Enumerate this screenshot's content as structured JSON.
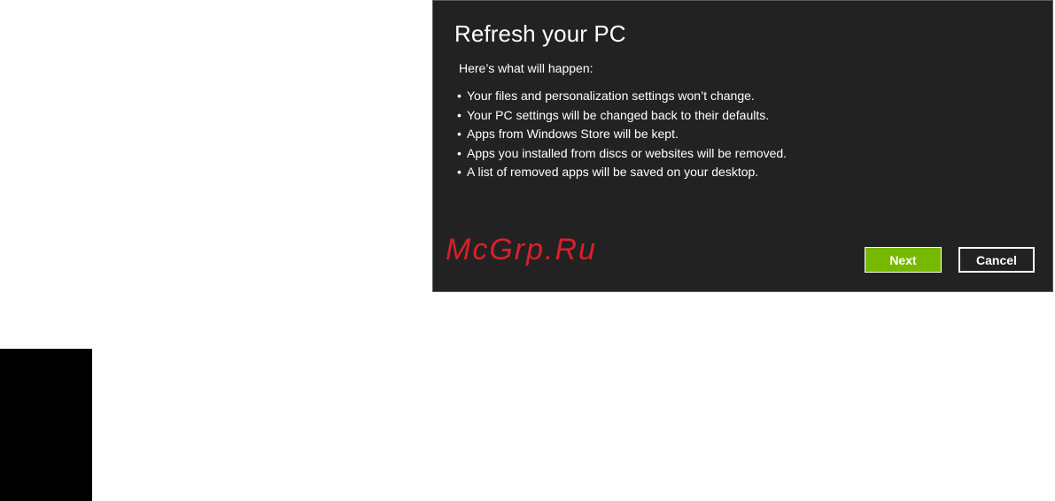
{
  "dialog": {
    "title": "Refresh your PC",
    "intro": "Here’s what will happen:",
    "bullet_char": "•",
    "bullets": [
      "Your files and personalization settings won’t change.",
      "Your PC settings will be changed back to their defaults.",
      "Apps from Windows Store will be kept.",
      "Apps you installed from discs or websites will be removed.",
      "A list of removed apps will be saved on your desktop."
    ],
    "next_label": "Next",
    "cancel_label": "Cancel"
  },
  "watermark": {
    "text": "McGrp.Ru"
  },
  "colors": {
    "dialog_background": "#222222",
    "next_button": "#76b900",
    "watermark": "#d9202a",
    "text": "#ffffff"
  }
}
